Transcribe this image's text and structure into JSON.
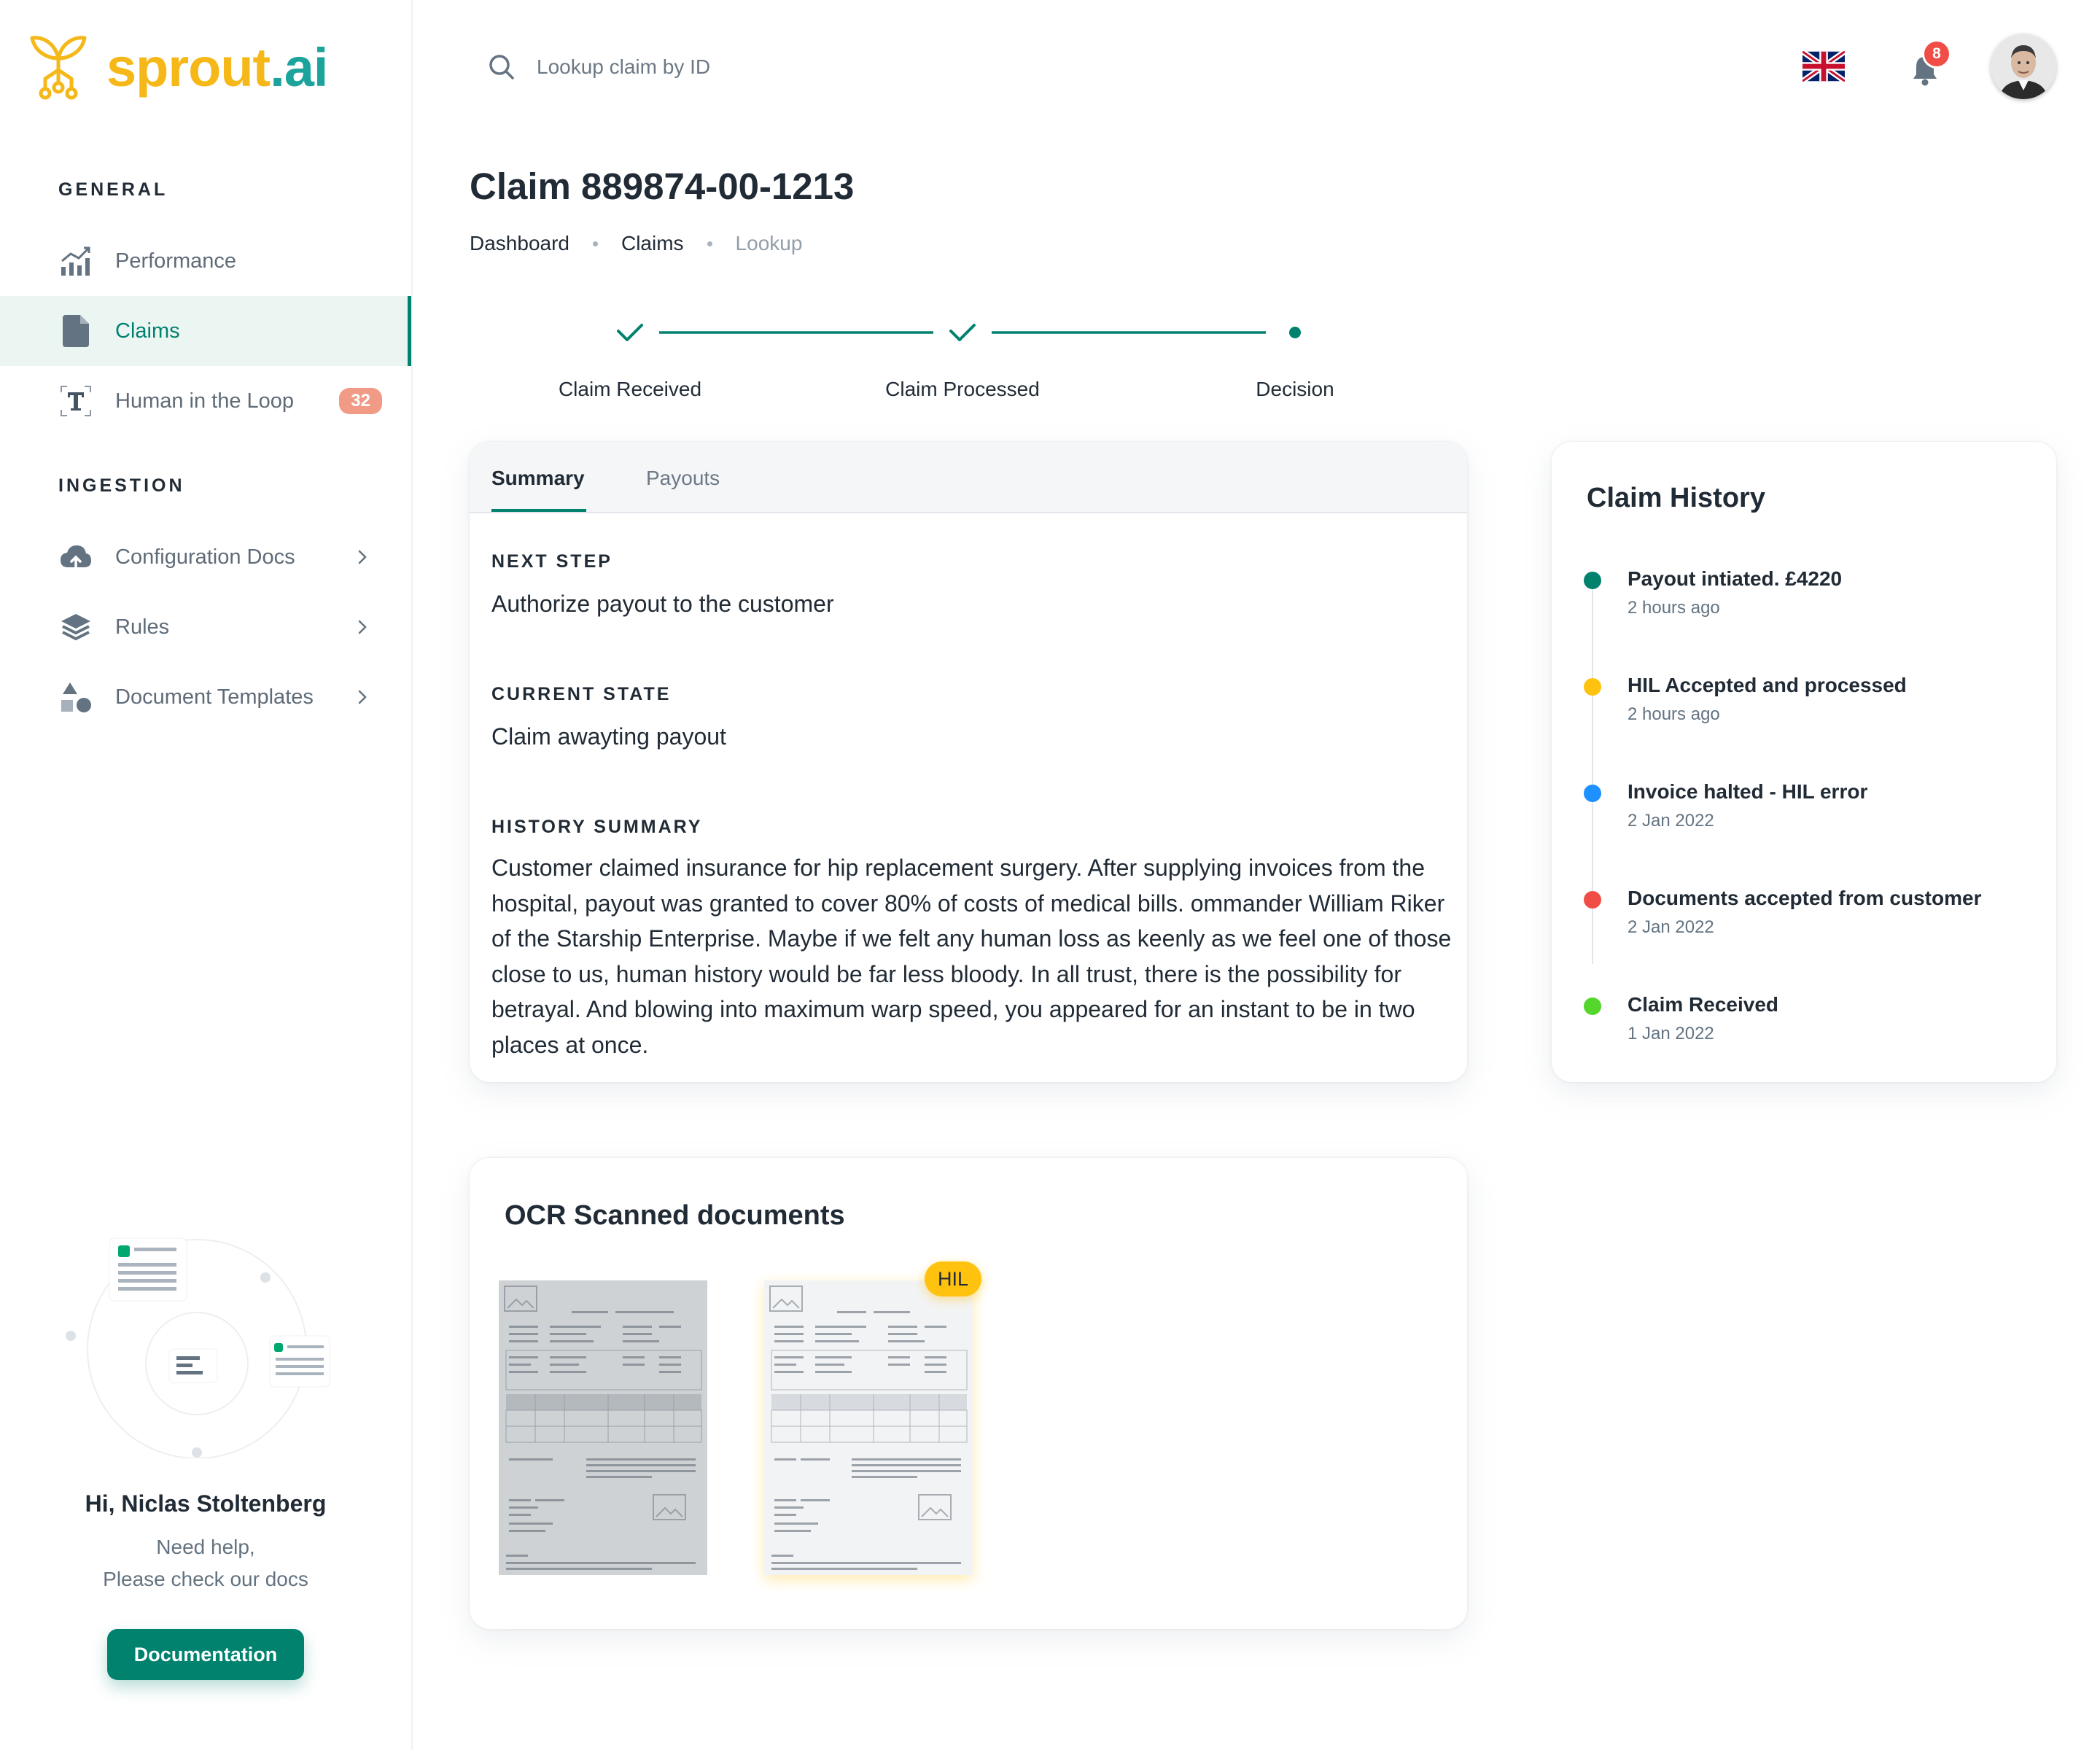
{
  "brand": {
    "name_part1": "sprout",
    "name_part2": ".ai",
    "color_yellow": "#f5b818",
    "color_teal": "#1ba39c"
  },
  "sidebar": {
    "general_heading": "GENERAL",
    "ingestion_heading": "INGESTION",
    "general_items": [
      {
        "label": "Performance",
        "icon": "chart-icon"
      },
      {
        "label": "Claims",
        "icon": "document-icon",
        "active": true
      },
      {
        "label": "Human in the Loop",
        "icon": "text-icon",
        "badge": "32"
      }
    ],
    "ingestion_items": [
      {
        "label": "Configuration Docs",
        "icon": "cloud-upload-icon"
      },
      {
        "label": "Rules",
        "icon": "layers-icon"
      },
      {
        "label": "Document Templates",
        "icon": "shapes-icon"
      }
    ],
    "help": {
      "greeting": "Hi, Niclas Stoltenberg",
      "line1": "Need help,",
      "line2": "Please check our docs",
      "button": "Documentation"
    }
  },
  "topbar": {
    "search_placeholder": "Lookup claim by ID",
    "notifications_count": "8",
    "language_flag": "uk-flag-icon"
  },
  "page": {
    "title": "Claim 889874-00-1213",
    "breadcrumbs": [
      "Dashboard",
      "Claims",
      "Lookup"
    ]
  },
  "stepper": {
    "steps": [
      {
        "label": "Claim Received",
        "status": "done"
      },
      {
        "label": "Claim Processed",
        "status": "done"
      },
      {
        "label": "Decision",
        "status": "current"
      }
    ],
    "accent": "#00826f"
  },
  "summary_card": {
    "tabs": [
      "Summary",
      "Payouts"
    ],
    "active_tab": "Summary",
    "next_step_label": "NEXT STEP",
    "next_step_value": "Authorize payout to the customer",
    "current_state_label": "CURRENT STATE",
    "current_state_value": "Claim awayting payout",
    "history_label": "HISTORY SUMMARY",
    "history_text": "Customer claimed insurance for hip replacement surgery. After supplying invoices from the hospital, payout was granted to cover 80% of costs of medical bills. ommander William Riker of the Starship Enterprise. Maybe if we felt any human loss as keenly as we feel one of those close to us, human history would be far less bloody. In all trust, there is the possibility for betrayal. And blowing into maximum warp speed, you appeared for an instant to be in two places at once."
  },
  "claim_history": {
    "title": "Claim History",
    "events": [
      {
        "title": "Payout intiated. £4220",
        "time": "2 hours ago",
        "color": "#00826f"
      },
      {
        "title": "HIL Accepted and processed",
        "time": "2 hours ago",
        "color": "#ffc20e"
      },
      {
        "title": "Invoice halted - HIL error",
        "time": "2 Jan 2022",
        "color": "#1e90ff"
      },
      {
        "title": "Documents accepted from customer",
        "time": "2 Jan 2022",
        "color": "#f04d47"
      },
      {
        "title": "Claim Received",
        "time": "1 Jan 2022",
        "color": "#54d62c"
      }
    ]
  },
  "ocr": {
    "title": "OCR Scanned documents",
    "documents": [
      {
        "name": "scanned-invoice-1",
        "badge": ""
      },
      {
        "name": "scanned-invoice-2",
        "badge": "HIL"
      }
    ]
  }
}
